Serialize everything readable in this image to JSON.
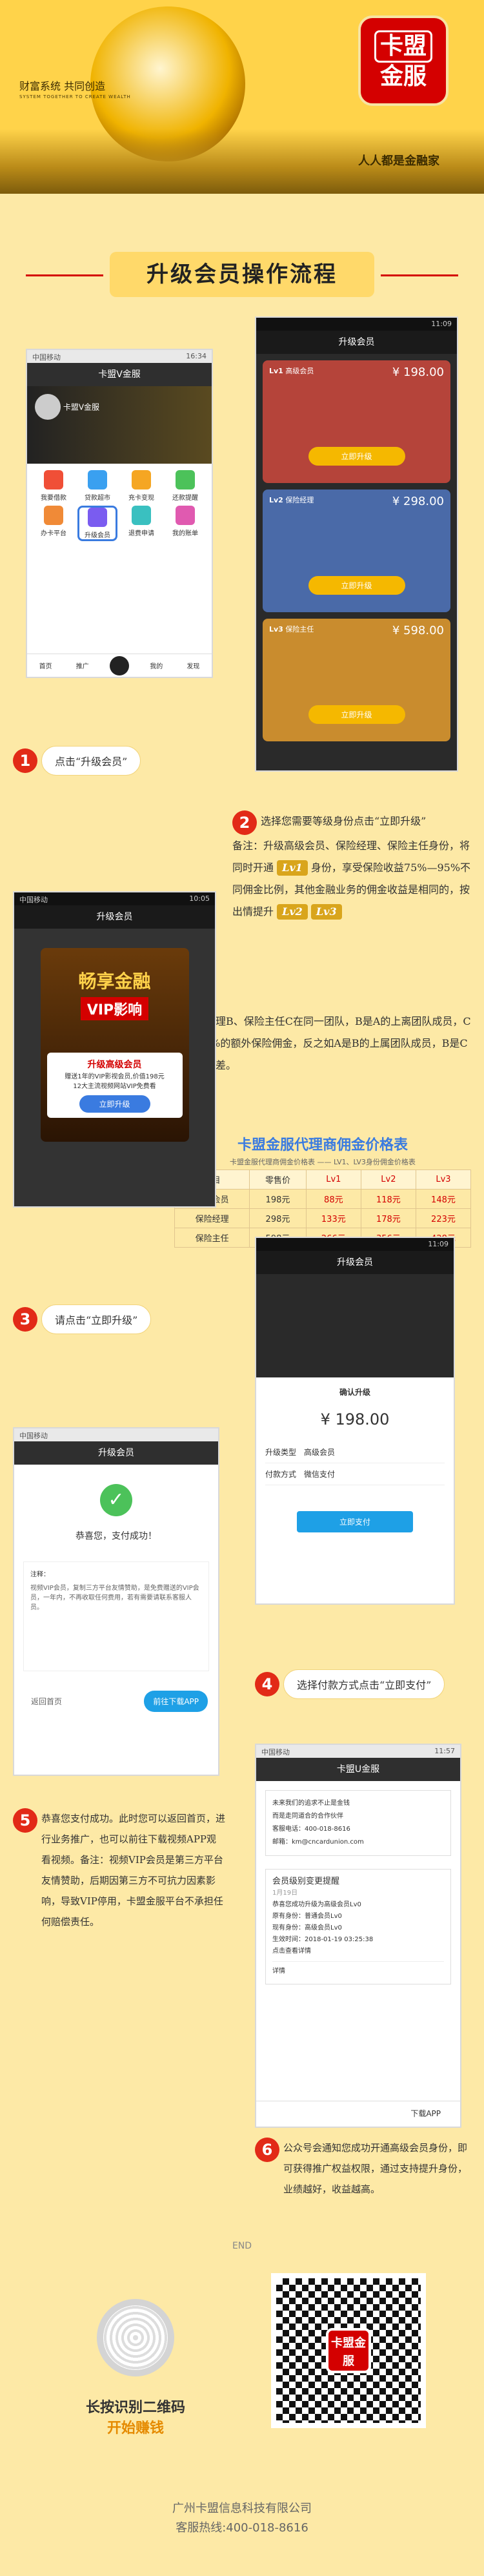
{
  "banner": {
    "slogan": "财富系统 共同创造",
    "slogan_en": "SYSTEM TOGETHER TO CREATE WEALTH",
    "logo_top": "卡盟",
    "logo_bottom": "金服",
    "logo_en": "Credit Union",
    "tagline": "人人都是金融家"
  },
  "title": "升级会员操作流程",
  "step1": {
    "num": "1",
    "text": "点击“升级会员”",
    "phone": {
      "status_left": "中国移动",
      "status_right": "16:34",
      "nav": "卡盟V金服",
      "user": "卡盟V金服",
      "grid": [
        "我要借款",
        "贷款超市",
        "充卡变现",
        "还款提醒",
        "办卡平台",
        "升级会员",
        "退费申请",
        "我的账单"
      ],
      "highlight": "升级会员",
      "tabs": [
        "首页",
        "推广",
        "",
        "我的",
        "发现"
      ]
    }
  },
  "step1b": {
    "phone": {
      "status_right": "11:09",
      "nav": "升级会员",
      "cards": [
        {
          "level": "Lv1",
          "name": "高级会员",
          "price": "¥ 198.00",
          "btn": "立即升级",
          "color": "#b5443a"
        },
        {
          "level": "Lv2",
          "name": "保险经理",
          "price": "¥ 298.00",
          "btn": "立即升级",
          "color": "#4a6aa8"
        },
        {
          "level": "Lv3",
          "name": "保险主任",
          "price": "¥ 598.00",
          "btn": "立即升级",
          "color": "#c98c2e"
        }
      ]
    }
  },
  "step2": {
    "num": "2",
    "text_a": "选择您需要等级身份点击“立即升级”",
    "text_b": "备注：升级高级会员、保险经理、保险主任身份，将同时开通",
    "lv1": "Lv1",
    "text_c": "身份，享受保险收益75%—95%不同佣金比例，其他金融业务的佣金收益是相同的，按出情提升",
    "lv2": "Lv2",
    "lv3": "Lv3",
    "text_d": "身份越高，佣金越高。如高级会员、保险经理B、保险主任C在同一团队，B是A的上离团队成员，C是B的上离团队成员，C和B得分别享受10%的额外保险佣金，反之如A是B的上属团队成员，B是C的上属团队成员，将无法享受额外保险佣金差。",
    "table_title": "卡盟金服代理商佣金价格表",
    "table_sub": "卡盟金服代理商佣金价格表 —— LV1、LV3身份佣金价格表",
    "header": [
      "项目",
      "零售价",
      "Lv1",
      "Lv2",
      "Lv3"
    ],
    "rows": [
      [
        "高级会员",
        "198元",
        "88元",
        "118元",
        "148元"
      ],
      [
        "保险经理",
        "298元",
        "133元",
        "178元",
        "223元"
      ],
      [
        "保险主任",
        "598元",
        "266元",
        "356元",
        "428元"
      ]
    ]
  },
  "step3": {
    "num": "3",
    "text": "请点击“立即升级”",
    "phone": {
      "status_left": "中国移动",
      "status_right": "10:05",
      "nav": "升级会员",
      "promo_title": "畅享金融",
      "promo_sub": "VIP影响",
      "popup_title": "升级高级会员",
      "popup_desc": "赠送1年的VIP影视会员,价值198元",
      "popup_desc2": "12大主流视频网站VIP免费看",
      "btn": "立即升级"
    }
  },
  "step4": {
    "num": "4",
    "text": "选择付款方式点击“立即支付”",
    "phone": {
      "status_right": "11:09",
      "nav": "升级会员",
      "dialog_title": "确认升级",
      "amount": "¥ 198.00",
      "row1_label": "升级类型",
      "row1_value": "高级会员",
      "row2_label": "付款方式",
      "row2_value": "微信支付",
      "btn": "立即支付"
    }
  },
  "step5": {
    "num": "5",
    "text": "恭喜您支付成功。此时您可以返回首页，进行业务推广，也可以前往下载视频APP观看视频。备注：视频VIP会员是第三方平台友情赞助，后期因第三方不可抗力因素影响，导致VIP停用，卡盟金服平台不承担任何赔偿责任。",
    "phone": {
      "status_left": "中国移动",
      "nav": "升级会员",
      "success": "恭喜您，支付成功！",
      "note_title": "注释：",
      "note": "视频VIP会员，复制三方平台友情赞助，是免费赠送的VIP会员，一年内，不再收取任何费用，若有需要请联系客服人员。",
      "back": "返回首页",
      "download": "前往下载APP"
    }
  },
  "step6": {
    "num": "6",
    "text": "公众号会通知您成功开通高级会员身份，即可获得推广权益权限，通过支持提升身份，业绩越好，收益越高。",
    "phone": {
      "status_left": "中国移动",
      "status_right": "11:57",
      "nav": "卡盟U金服",
      "msg1": "未来我们的追求不止是金钱",
      "msg2": "而是走同道合的合作伙伴",
      "msg3": "客服电话：400-018-8616",
      "msg4": "邮箱：km@cncardunion.com",
      "notice_title": "会员级别变更提醒",
      "notice_date": "1月19日",
      "notice_l1": "恭喜您成功升级为高级会员Lv0",
      "notice_l2": "原有身份：普通会员Lv0",
      "notice_l3": "现有身份：高级会员Lv0",
      "notice_l4": "生效时间：2018-01-19 03:25:38",
      "notice_l5": "点击查看详情",
      "link": "详情",
      "menu": "下载APP"
    }
  },
  "footer": {
    "end": "END",
    "scan1": "长按识别二维码",
    "scan2": "开始赚钱",
    "company": "广州卡盟信息科技有限公司",
    "hotline": "客服热线:400-018-8616",
    "qr_logo": "卡盟金服"
  }
}
